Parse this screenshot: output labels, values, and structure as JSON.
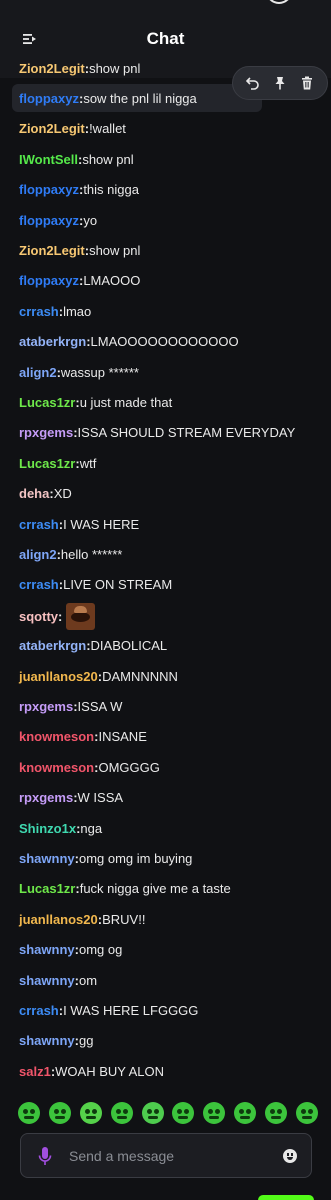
{
  "header": {
    "title": "Chat"
  },
  "actions": {
    "reply": "reply-icon",
    "pin": "pin-icon",
    "delete": "trash-icon"
  },
  "messages": [
    {
      "user": "Zion2Legit",
      "color": "#f7c873",
      "text": "show pnl"
    },
    {
      "user": "floppaxyz",
      "color": "#2f7cf6",
      "text": "sow the pnl lil nigga"
    },
    {
      "user": "Zion2Legit",
      "color": "#f7c873",
      "text": "!wallet"
    },
    {
      "user": "IWontSell",
      "color": "#55e94a",
      "text": "show pnl"
    },
    {
      "user": "floppaxyz",
      "color": "#2f7cf6",
      "text": "this nigga"
    },
    {
      "user": "floppaxyz",
      "color": "#2f7cf6",
      "text": "yo"
    },
    {
      "user": "Zion2Legit",
      "color": "#f7c873",
      "text": "show pnl"
    },
    {
      "user": "floppaxyz",
      "color": "#2f7cf6",
      "text": "LMAOOO"
    },
    {
      "user": "crrash",
      "color": "#3d8cf5",
      "text": "lmao"
    },
    {
      "user": "ataberkrgn",
      "color": "#93b3f7",
      "text": "LMAOOOOOOOOOOOO"
    },
    {
      "user": "align2",
      "color": "#7ea6f7",
      "text": "wassup ******"
    },
    {
      "user": "Lucas1zr",
      "color": "#6ee84a",
      "text": "u just made that"
    },
    {
      "user": "rpxgems",
      "color": "#c59cf7",
      "text": "ISSA SHOULD STREAM EVERYDAY"
    },
    {
      "user": "Lucas1zr",
      "color": "#6ee84a",
      "text": "wtf"
    },
    {
      "user": "deha",
      "color": "#f2c4c4",
      "text": "XD"
    },
    {
      "user": "crrash",
      "color": "#3d8cf5",
      "text": "I WAS HERE"
    },
    {
      "user": "align2",
      "color": "#7ea6f7",
      "text": "hello ******"
    },
    {
      "user": "crrash",
      "color": "#3d8cf5",
      "text": "LIVE ON STREAM"
    },
    {
      "user": "sqotty",
      "color": "#f7c0c0",
      "text": "",
      "emote": "meme-face-emote"
    },
    {
      "user": "ataberkrgn",
      "color": "#93b3f7",
      "text": "DIABOLICAL"
    },
    {
      "user": "juanllanos20",
      "color": "#f2b84e",
      "text": "DAMNNNNN"
    },
    {
      "user": "rpxgems",
      "color": "#c59cf7",
      "text": "ISSA W"
    },
    {
      "user": "knowmeson",
      "color": "#f0556a",
      "text": "INSANE"
    },
    {
      "user": "knowmeson",
      "color": "#f0556a",
      "text": "OMGGGG"
    },
    {
      "user": "rpxgems",
      "color": "#c59cf7",
      "text": "W ISSA"
    },
    {
      "user": "Shinzo1x",
      "color": "#3fd9b0",
      "text": "nga"
    },
    {
      "user": "shawnny",
      "color": "#7ea6f7",
      "text": "omg omg im buying"
    },
    {
      "user": "Lucas1zr",
      "color": "#6ee84a",
      "text": "fuck nigga give me a taste"
    },
    {
      "user": "juanllanos20",
      "color": "#f2b84e",
      "text": "BRUV!!"
    },
    {
      "user": "shawnny",
      "color": "#7ea6f7",
      "text": "omg og"
    },
    {
      "user": "shawnny",
      "color": "#7ea6f7",
      "text": "om"
    },
    {
      "user": "crrash",
      "color": "#3d8cf5",
      "text": "I WAS HERE LFGGGG"
    },
    {
      "user": "shawnny",
      "color": "#7ea6f7",
      "text": "gg"
    },
    {
      "user": "salz1",
      "color": "#f0556a",
      "text": "WOAH BUY ALON"
    }
  ],
  "emotes": [
    "emote-1",
    "emote-2",
    "emote-3",
    "emote-4",
    "emote-5",
    "emote-6",
    "emote-7",
    "emote-8",
    "emote-9",
    "emote-10"
  ],
  "input": {
    "placeholder": "Send a message"
  },
  "accent": "#53fc18"
}
